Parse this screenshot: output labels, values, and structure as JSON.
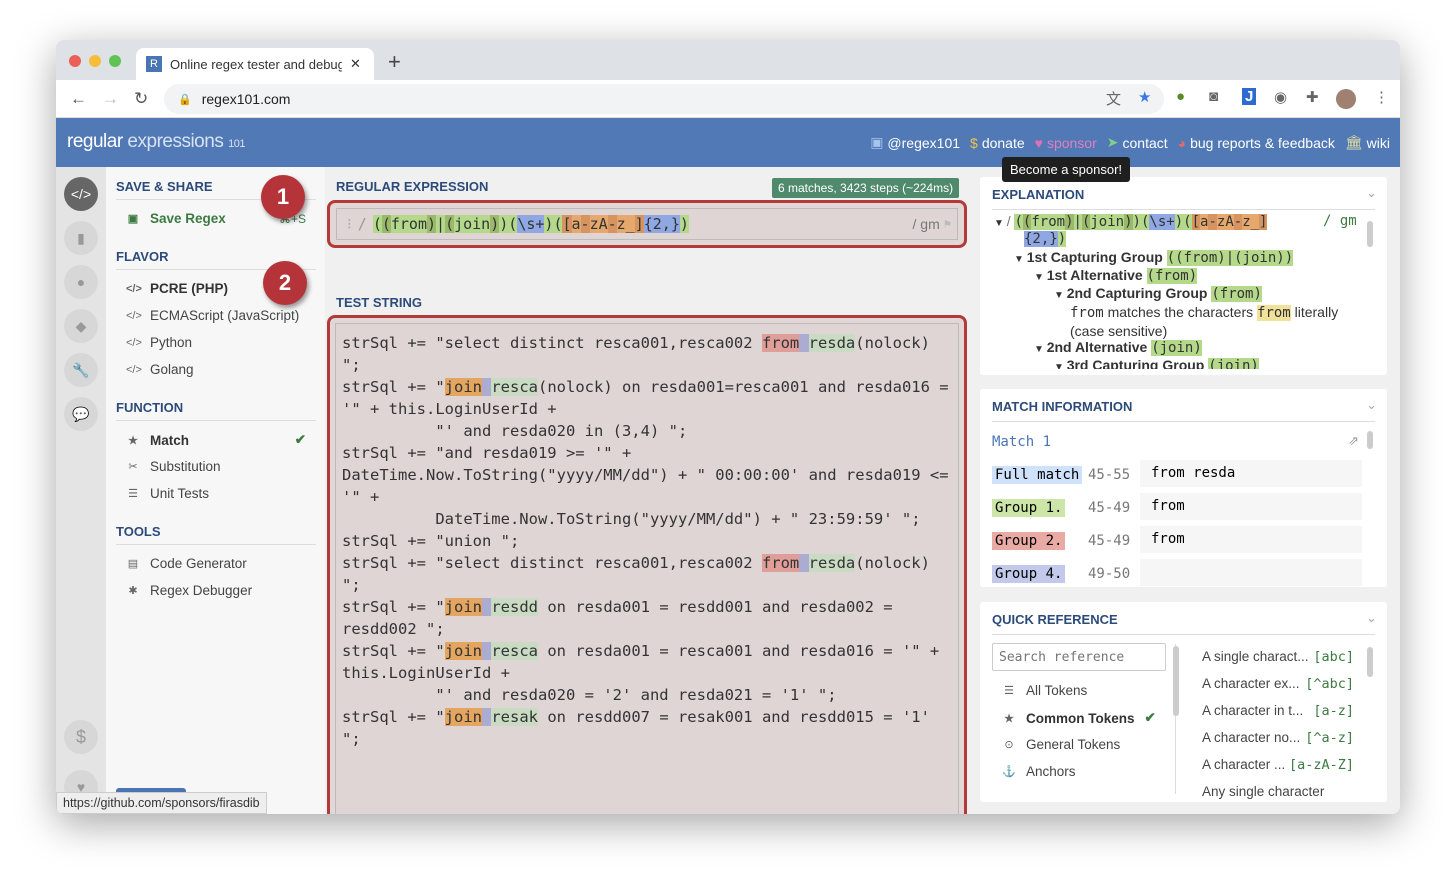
{
  "browser": {
    "tab_title": "Online regex tester and debugg",
    "favicon": "R",
    "url": "regex101.com",
    "new_tab": "+"
  },
  "header": {
    "logo_a": "regular",
    "logo_b": " expressions",
    "logo_c": "101",
    "links": [
      {
        "icon": "twitter-icon",
        "label": "@regex101"
      },
      {
        "icon": "dollar-icon",
        "label": "donate"
      },
      {
        "icon": "heart-icon",
        "label": "sponsor"
      },
      {
        "icon": "send-icon",
        "label": "contact"
      },
      {
        "icon": "github-icon",
        "label": "bug reports & feedback"
      },
      {
        "icon": "bank-icon",
        "label": "wiki"
      }
    ],
    "tooltip": "Become a sponsor!"
  },
  "sidebar": {
    "save_title": "SAVE & SHARE",
    "save_label": "Save Regex",
    "save_shortcut": "⌘+S",
    "flavor_title": "FLAVOR",
    "flavors": [
      "PCRE (PHP)",
      "ECMAScript (JavaScript)",
      "Python",
      "Golang"
    ],
    "function_title": "FUNCTION",
    "functions": [
      "Match",
      "Substitution",
      "Unit Tests"
    ],
    "tools_title": "TOOLS",
    "tools": [
      "Code Generator",
      "Regex Debugger"
    ]
  },
  "annotations": [
    "1",
    "2"
  ],
  "regex": {
    "label": "REGULAR EXPRESSION",
    "status": "6 matches, 3423 steps (~224ms)",
    "delimiter": "/",
    "flags": "/ gm",
    "tokens": [
      [
        "(",
        "gl"
      ],
      [
        "(",
        "gd"
      ],
      [
        "from",
        "gl"
      ],
      [
        ")",
        "gd"
      ],
      [
        "|",
        "gl"
      ],
      [
        "(",
        "gd"
      ],
      [
        "join",
        "gl"
      ],
      [
        ")",
        "gd"
      ],
      [
        ")",
        "gl"
      ],
      [
        "(",
        "gl"
      ],
      [
        "\\s+",
        "bl"
      ],
      [
        ")",
        "gl"
      ],
      [
        "(",
        "gl"
      ],
      [
        "[",
        "od"
      ],
      [
        "a",
        "or"
      ],
      [
        "-",
        "od"
      ],
      [
        "zA",
        "or"
      ],
      [
        "-",
        "od"
      ],
      [
        "z_",
        "or"
      ],
      [
        "]",
        "od"
      ],
      [
        "{2,}",
        "bl"
      ],
      [
        ")",
        "gl"
      ]
    ]
  },
  "test_string": {
    "label": "TEST STRING",
    "lines": [
      [
        [
          "strSql += \"select distinct resca001,resca002 ",
          ""
        ],
        [
          "from",
          "mf"
        ],
        [
          " ",
          "ms"
        ],
        [
          "resda",
          "mt"
        ],
        [
          "(nolock)",
          ""
        ]
      ],
      [
        [
          "\";",
          ""
        ]
      ],
      [
        [
          "strSql += \"",
          ""
        ],
        [
          "join",
          "mj"
        ],
        [
          " ",
          "ms"
        ],
        [
          "resca",
          "mt"
        ],
        [
          "(nolock) on resda001=resca001 and resda016 =",
          ""
        ]
      ],
      [
        [
          "'\" + this.LoginUserId +",
          ""
        ]
      ],
      [
        [
          "          \"' and resda020 in (3,4) \";",
          ""
        ]
      ],
      [
        [
          "strSql += \"and resda019 >= '\" +",
          ""
        ]
      ],
      [
        [
          "DateTime.Now.ToString(\"yyyy/MM/dd\") + \" 00:00:00' and resda019 <=",
          ""
        ]
      ],
      [
        [
          "'\" +",
          ""
        ]
      ],
      [
        [
          "          DateTime.Now.ToString(\"yyyy/MM/dd\") + \" 23:59:59' \";",
          ""
        ]
      ],
      [
        [
          "strSql += \"union \";",
          ""
        ]
      ],
      [
        [
          "strSql += \"select distinct resca001,resca002 ",
          ""
        ],
        [
          "from",
          "mf"
        ],
        [
          " ",
          "ms"
        ],
        [
          "resda",
          "mt"
        ],
        [
          "(nolock)",
          ""
        ]
      ],
      [
        [
          "\";",
          ""
        ]
      ],
      [
        [
          "strSql += \"",
          ""
        ],
        [
          "join",
          "mj"
        ],
        [
          " ",
          "ms"
        ],
        [
          "resdd",
          "mt"
        ],
        [
          " on resda001 = resdd001 and resda002 =",
          ""
        ]
      ],
      [
        [
          "resdd002 \";",
          ""
        ]
      ],
      [
        [
          "strSql += \"",
          ""
        ],
        [
          "join",
          "mj"
        ],
        [
          " ",
          "ms"
        ],
        [
          "resca",
          "mt"
        ],
        [
          " on resda001 = resca001 and resda016 = '\" +",
          ""
        ]
      ],
      [
        [
          "this.LoginUserId +",
          ""
        ]
      ],
      [
        [
          "          \"' and resda020 = '2' and resda021 = '1' \";",
          ""
        ]
      ],
      [
        [
          "strSql += \"",
          ""
        ],
        [
          "join",
          "mj"
        ],
        [
          " ",
          "ms"
        ],
        [
          "resak",
          "mt"
        ],
        [
          " on resdd007 = resak001 and resdd015 = '1'",
          ""
        ]
      ],
      [
        [
          "\";",
          ""
        ]
      ]
    ]
  },
  "explanation": {
    "title": "EXPLANATION",
    "flags": "/ gm",
    "regex_line2": "{2,}",
    "items": [
      {
        "title": "1st Capturing Group",
        "token": "((from)|(join))"
      },
      {
        "title": "1st Alternative",
        "token": "(from)"
      },
      {
        "title": "2nd Capturing Group",
        "token": "(from)"
      },
      {
        "desc_a": "from",
        "desc_b": " matches the characters ",
        "desc_c": "from",
        "desc_d": " literally",
        "desc_e": "(case sensitive)"
      },
      {
        "title": "2nd Alternative",
        "token": "(join)"
      },
      {
        "title": "3rd Capturing Group",
        "token": "(join)"
      }
    ]
  },
  "match_info": {
    "title": "MATCH INFORMATION",
    "match": "Match 1",
    "rows": [
      {
        "label": "Full match",
        "range": "45-55",
        "value": "from resda",
        "color": "#cfe2fb"
      },
      {
        "label": "Group 1.",
        "range": "45-49",
        "value": "from",
        "color": "#cbe6a6"
      },
      {
        "label": "Group 2.",
        "range": "45-49",
        "value": "from",
        "color": "#e9aaa3"
      },
      {
        "label": "Group 4.",
        "range": "49-50",
        "value": "",
        "color": "#c3c9ea"
      }
    ]
  },
  "quick_ref": {
    "title": "QUICK REFERENCE",
    "search_placeholder": "Search reference",
    "categories": [
      {
        "icon": "database-icon",
        "label": "All Tokens"
      },
      {
        "icon": "star-icon",
        "label": "Common Tokens",
        "selected": true
      },
      {
        "icon": "target-icon",
        "label": "General Tokens"
      },
      {
        "icon": "anchor-icon",
        "label": "Anchors"
      }
    ],
    "tokens": [
      {
        "desc": "A single charact...",
        "token": "[abc]"
      },
      {
        "desc": "A character ex...",
        "token": "[^abc]"
      },
      {
        "desc": "A character in t...",
        "token": "[a-z]"
      },
      {
        "desc": "A character no...",
        "token": "[^a-z]"
      },
      {
        "desc": "A character ...",
        "token": "[a-zA-Z]"
      },
      {
        "desc": "Any single character",
        "token": ""
      }
    ]
  },
  "status_url": "https://github.com/sponsors/firasdib"
}
